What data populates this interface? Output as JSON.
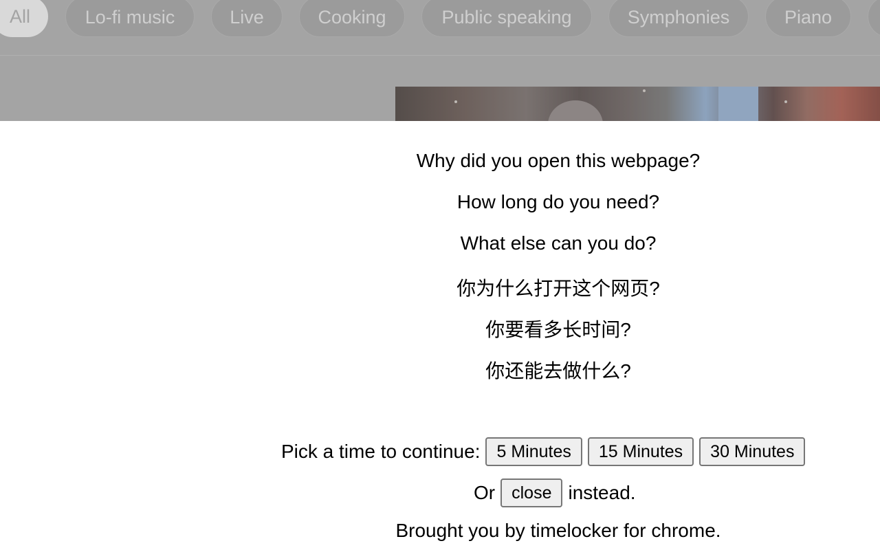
{
  "chips": [
    {
      "label": "All",
      "active": true
    },
    {
      "label": "Lo-fi music",
      "active": false
    },
    {
      "label": "Live",
      "active": false
    },
    {
      "label": "Cooking",
      "active": false
    },
    {
      "label": "Public speaking",
      "active": false
    },
    {
      "label": "Symphonies",
      "active": false
    },
    {
      "label": "Piano",
      "active": false
    }
  ],
  "questions": {
    "q1": "Why did you open this webpage?",
    "q2": "How long do you need?",
    "q3": "What else can you do?",
    "q4": "你为什么打开这个网页?",
    "q5": "你要看多长时间?",
    "q6": "你还能去做什么?"
  },
  "pick": {
    "label": "Pick a time to continue:",
    "options": [
      "5 Minutes",
      "15 Minutes",
      "30 Minutes"
    ]
  },
  "alt": {
    "prefix": "Or",
    "close_label": "close",
    "suffix": "instead."
  },
  "credit": "Brought you by timelocker for chrome."
}
